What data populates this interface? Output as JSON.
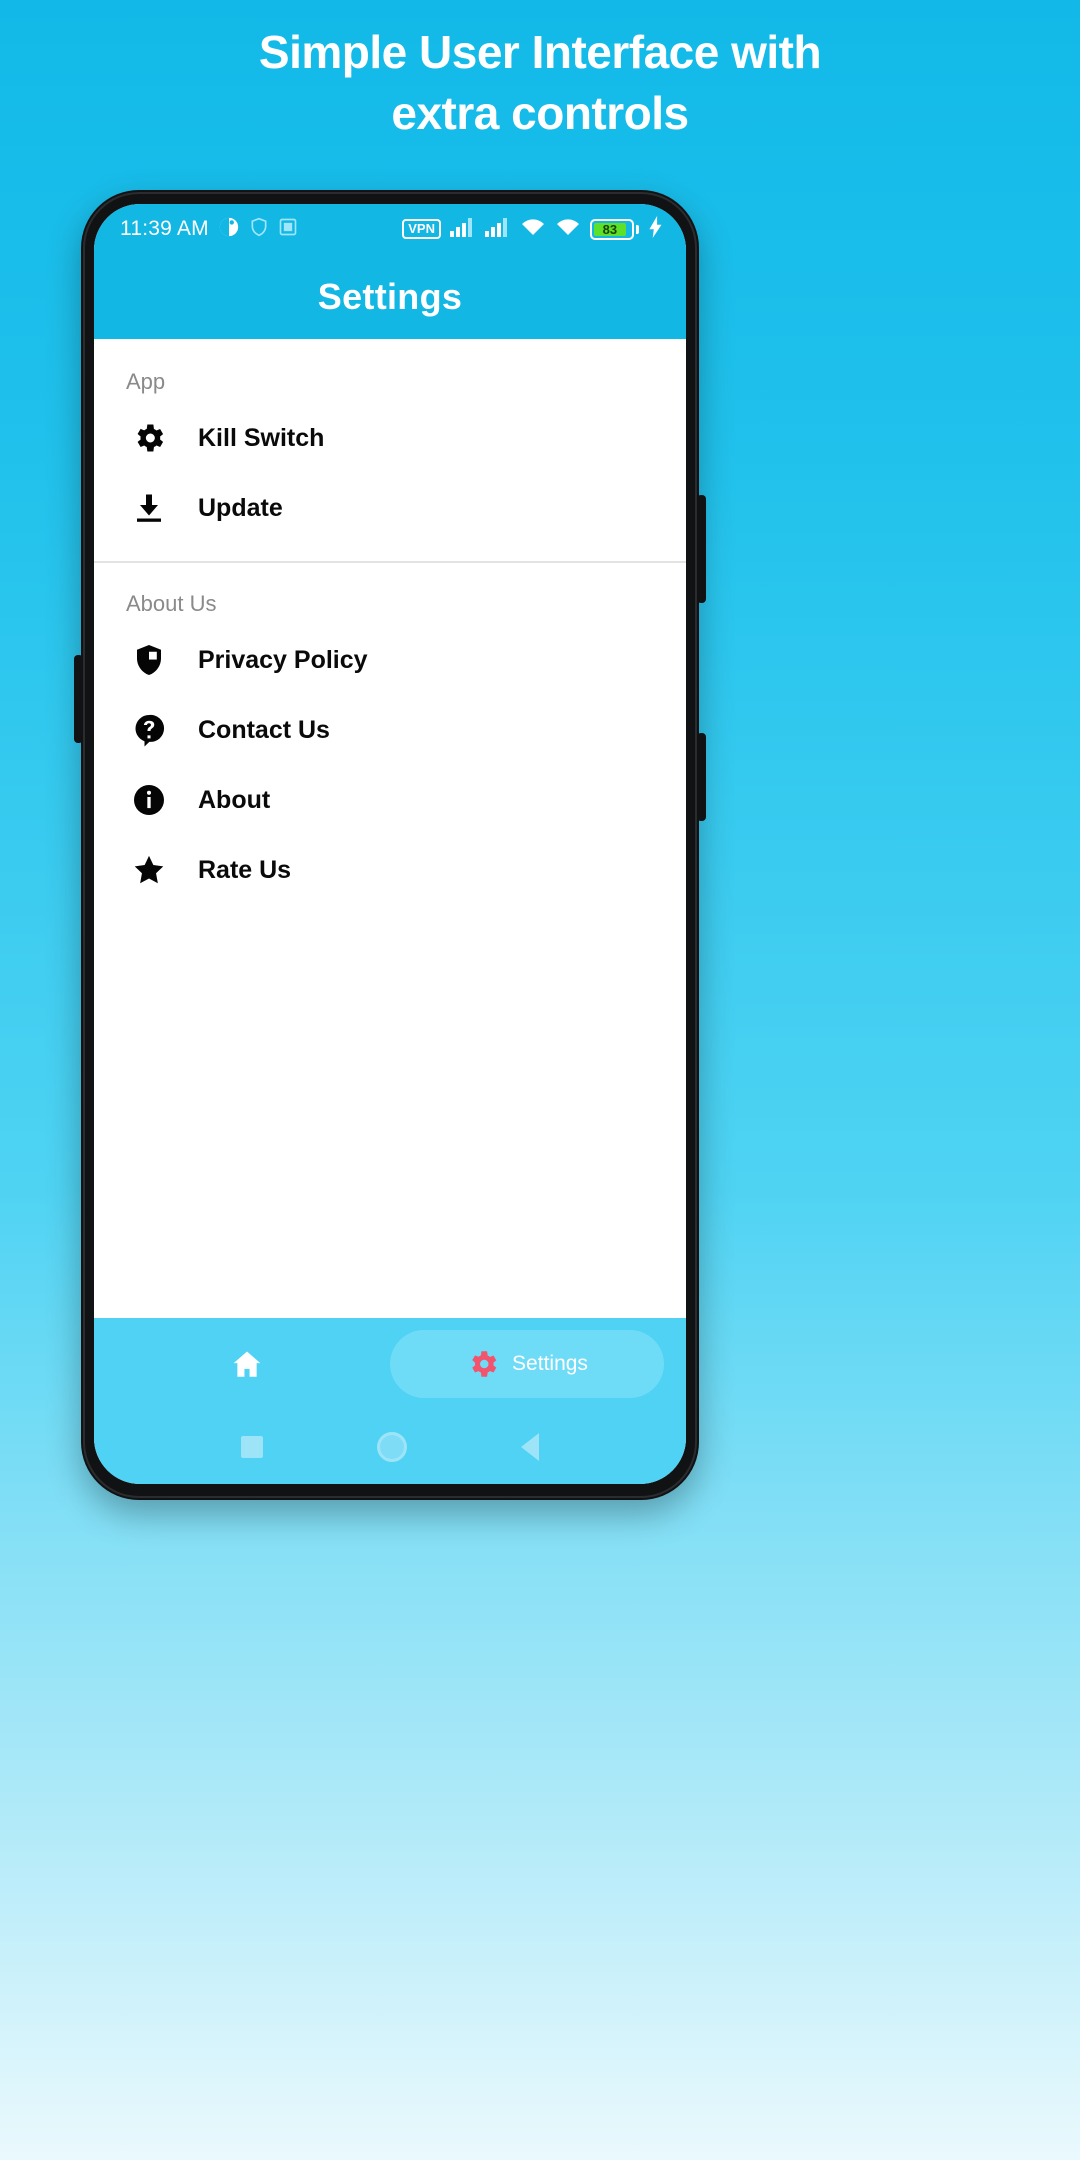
{
  "promo": {
    "headline_line1": "Simple User Interface with",
    "headline_line2": "extra controls"
  },
  "statusbar": {
    "time": "11:39 AM",
    "vpn_label": "VPN",
    "battery_percent": "83",
    "icons": [
      "clock-face-icon",
      "shield-n-icon",
      "screenshot-icon",
      "vpn-badge",
      "signal-bars-icon",
      "signal-bars-icon",
      "wifi-icon",
      "wifi-icon",
      "battery-icon",
      "charging-bolt-icon"
    ]
  },
  "appbar": {
    "title": "Settings"
  },
  "sections": [
    {
      "header": "App",
      "items": [
        {
          "label": "Kill Switch",
          "icon": "gear-icon"
        },
        {
          "label": "Update",
          "icon": "download-icon"
        }
      ]
    },
    {
      "header": "About Us",
      "items": [
        {
          "label": "Privacy Policy",
          "icon": "shield-icon"
        },
        {
          "label": "Contact Us",
          "icon": "question-bubble-icon"
        },
        {
          "label": "About",
          "icon": "info-icon"
        },
        {
          "label": "Rate Us",
          "icon": "star-icon"
        }
      ]
    }
  ],
  "tabbar": {
    "tabs": [
      {
        "label": "",
        "icon": "home-icon",
        "active": false
      },
      {
        "label": "Settings",
        "icon": "gear-icon",
        "active": true
      }
    ]
  },
  "navbar": {
    "buttons": [
      "recents-square-icon",
      "home-circle-icon",
      "back-triangle-icon"
    ]
  },
  "colors": {
    "brand_blue": "#12B7E4",
    "tab_blue": "#4FD2F4",
    "tab_active_blue": "#6FDCF7",
    "accent_pink": "#F2546E",
    "battery_green": "#5DE02A",
    "section_header_gray": "#8a8a8a"
  }
}
